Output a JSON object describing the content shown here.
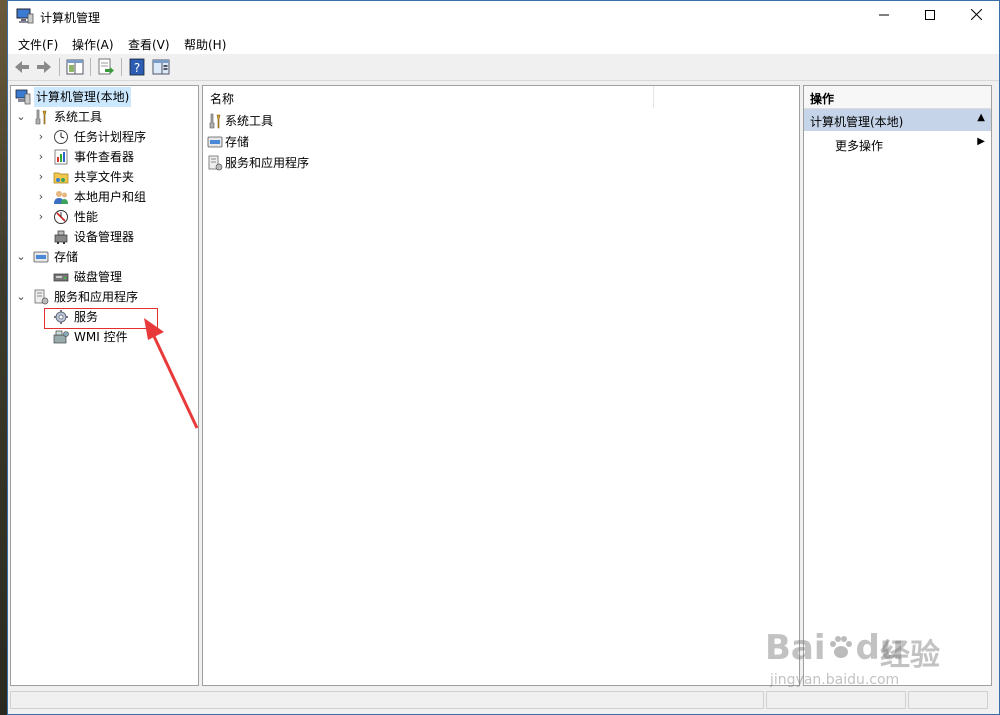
{
  "window": {
    "title": "计算机管理"
  },
  "menu": [
    "文件(F)",
    "操作(A)",
    "查看(V)",
    "帮助(H)"
  ],
  "toolbar": {
    "back": "back-arrow-icon",
    "forward": "forward-arrow-icon",
    "show_tree": "console-tree-icon",
    "export": "export-list-icon",
    "help": "help-icon",
    "show_action": "action-pane-icon"
  },
  "tree": {
    "root": "计算机管理(本地)",
    "system_tools": "系统工具",
    "task_scheduler": "任务计划程序",
    "event_viewer": "事件查看器",
    "shared_folders": "共享文件夹",
    "local_users": "本地用户和组",
    "performance": "性能",
    "device_manager": "设备管理器",
    "storage": "存储",
    "disk_management": "磁盘管理",
    "services_apps": "服务和应用程序",
    "services": "服务",
    "wmi": "WMI 控件"
  },
  "list": {
    "column_name": "名称",
    "items": [
      "系统工具",
      "存储",
      "服务和应用程序"
    ]
  },
  "actions": {
    "header": "操作",
    "section": "计算机管理(本地)",
    "more": "更多操作"
  },
  "watermark": {
    "brand": "Bai",
    "brand2": "du",
    "cn": "经验",
    "url": "jingyan.baidu.com"
  },
  "colors": {
    "highlight": "#e03030",
    "selection": "#cce8ff",
    "action_header": "#c5d4e8"
  }
}
